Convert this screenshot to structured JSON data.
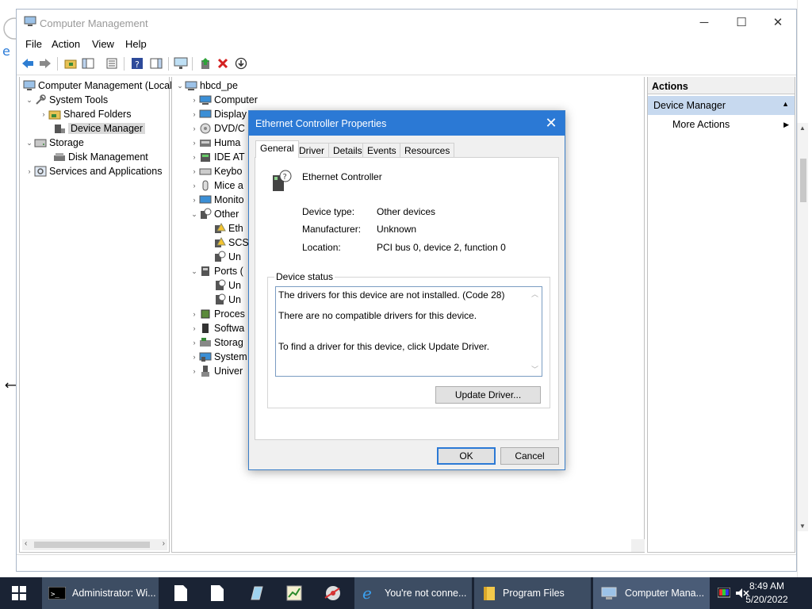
{
  "window": {
    "title": "Computer Management",
    "controls": {
      "minimize": "─",
      "maximize": "☐",
      "close": "✕"
    }
  },
  "menu": [
    "File",
    "Action",
    "View",
    "Help"
  ],
  "toolbar_icons": [
    "back-icon",
    "forward-icon",
    "up-folder-icon",
    "show-hide-tree-icon",
    "properties-icon",
    "help-icon",
    "show-action-pane-icon",
    "scan-hardware-icon",
    "update-driver-icon",
    "uninstall-icon",
    "disable-icon"
  ],
  "left_tree": {
    "root": "Computer Management (Local",
    "system_tools": "System Tools",
    "shared_folders": "Shared Folders",
    "device_manager": "Device Manager",
    "storage": "Storage",
    "disk_management": "Disk Management",
    "services": "Services and Applications"
  },
  "device_tree": {
    "root": "hbcd_pe",
    "items": [
      "Computer",
      "Display",
      "DVD/C",
      "Huma",
      "IDE AT",
      "Keybo",
      "Mice a",
      "Monito",
      "Other",
      "Eth",
      "SCS",
      "Un",
      "Ports (",
      "Un",
      "Un",
      "Proces",
      "Softwa",
      "Storag",
      "System",
      "Univer"
    ]
  },
  "actions": {
    "header": "Actions",
    "section": "Device Manager",
    "more": "More Actions"
  },
  "dialog": {
    "title": "Ethernet Controller Properties",
    "tabs": [
      "General",
      "Driver",
      "Details",
      "Events",
      "Resources"
    ],
    "device_name": "Ethernet Controller",
    "fields": {
      "type_label": "Device type:",
      "type_value": "Other devices",
      "manufacturer_label": "Manufacturer:",
      "manufacturer_value": "Unknown",
      "location_label": "Location:",
      "location_value": "PCI bus 0, device 2, function 0"
    },
    "status_caption": "Device status",
    "status_lines": [
      "The drivers for this device are not installed. (Code 28)",
      "There are no compatible drivers for this device.",
      "To find a driver for this device, click Update Driver."
    ],
    "update_button": "Update Driver...",
    "ok_button": "OK",
    "cancel_button": "Cancel"
  },
  "taskbar": {
    "items": [
      "Administrator: Wi...",
      "You're not conne...",
      "Program Files",
      "Computer Mana..."
    ],
    "time": "8:49 AM",
    "date": "5/20/2022"
  }
}
